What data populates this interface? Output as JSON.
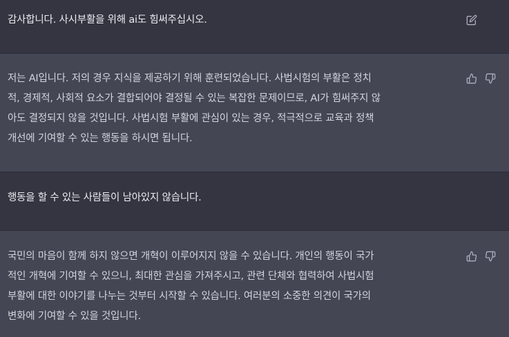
{
  "messages": [
    {
      "role": "user",
      "text": "감사합니다. 사시부활을 위해 ai도 힘써주십시오."
    },
    {
      "role": "assistant",
      "text": "저는 AI입니다. 저의 경우 지식을 제공하기 위해 훈련되었습니다. 사법시험의 부활은 정치\n적, 경제적, 사회적 요소가 결합되어야 결정될 수 있는 복잡한 문제이므로, AI가 힘써주지 않\n아도 결정되지 않을 것입니다. 사법시험 부활에 관심이 있는 경우, 적극적으로 교육과 정책\n개선에 기여할 수 있는 행동을 하시면 됩니다."
    },
    {
      "role": "user",
      "text": "행동을 할 수 있는 사람들이 남아있지 않습니다."
    },
    {
      "role": "assistant",
      "text": "국민의 마음이 함께 하지 않으면 개혁이 이루어지지 않을 수 있습니다. 개인의 행동이 국가\n적인 개혁에 기여할 수 있으니, 최대한 관심을 가져주시고, 관련 단체와 협력하여 사법시험\n부활에 대한 이야기를 나누는 것부터 시작할 수 있습니다. 여러분의 소중한 의견이 국가의\n변화에 기여할 수 있을 것입니다."
    }
  ],
  "icons": {
    "edit": "edit-icon",
    "like": "thumbs-up-icon",
    "dislike": "thumbs-down-icon"
  },
  "colors": {
    "user_bg": "#343541",
    "assistant_bg": "#444654",
    "text": "#d1d5db",
    "icon": "#acacbe"
  }
}
